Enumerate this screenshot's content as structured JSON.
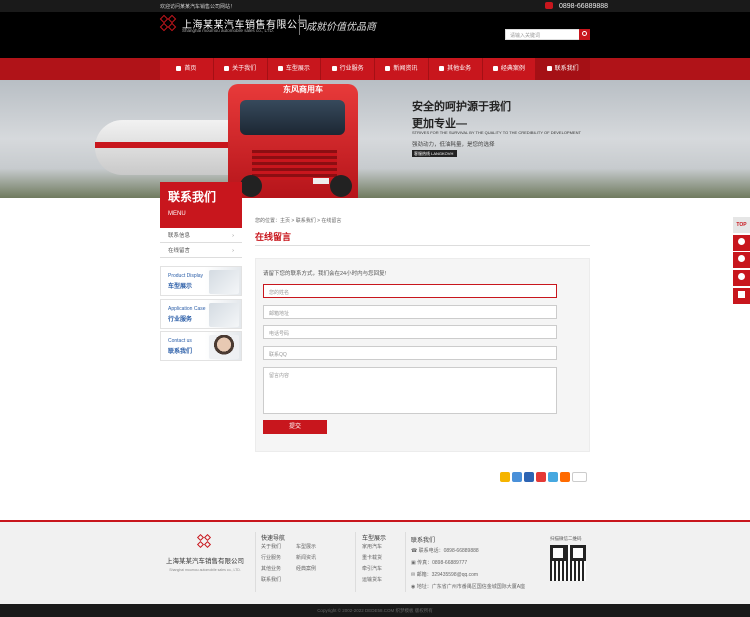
{
  "topbar": {
    "welcome": "欢迎访问某某汽车销售公司网站！",
    "phone": "0898-66889888"
  },
  "header": {
    "company_cn": "上海某某汽车销售有限公司",
    "company_en": "Shanghai moumou automobile sales co., LTD.",
    "slogan": "成就价值优品商",
    "search_placeholder": "请输入关键词"
  },
  "nav": [
    {
      "label": "首页",
      "icon": "home-icon"
    },
    {
      "label": "关于我们",
      "icon": "plane-icon"
    },
    {
      "label": "车型展示",
      "icon": "car-icon"
    },
    {
      "label": "行业服务",
      "icon": "gear-icon"
    },
    {
      "label": "新闻资讯",
      "icon": "news-icon"
    },
    {
      "label": "其他业务",
      "icon": "briefcase-icon"
    },
    {
      "label": "经典案例",
      "icon": "case-icon"
    },
    {
      "label": "联系我们",
      "icon": "phone-icon"
    }
  ],
  "banner": {
    "truck_text": "东风商用车",
    "line1": "安全的呵护源于我们",
    "line2": "更加专业—",
    "english": "STRIVES FOR THE SURVIVAL BY THE QUALITY TO THE CREDIBILITY OF DEVELOPMENT",
    "line3": "强劲动力，低油耗量，是您的选择",
    "button": "客服热线 LANGKOVH"
  },
  "sidebar": {
    "title_cn": "联系我们",
    "title_en": "MENU",
    "items": [
      {
        "label": "联系信息"
      },
      {
        "label": "在线留言"
      }
    ],
    "promos": [
      {
        "en": "Product Display",
        "cn": "车型展示"
      },
      {
        "en": "Application Case",
        "cn": "行业服务"
      },
      {
        "en": "Contact us",
        "cn": "联系我们"
      }
    ]
  },
  "main": {
    "breadcrumb": "您的位置：主页 > 联系我们 > 在线留言",
    "title": "在线留言",
    "intro": "请留下您的联系方式，我们会在24小时内与您回复!",
    "fields": {
      "name": "您的姓名",
      "email": "邮箱地址",
      "phone": "电话号码",
      "qq": "联系QQ",
      "message": "留言内容"
    },
    "submit": "提交"
  },
  "righttools": {
    "top": "TOP"
  },
  "footer": {
    "company_cn": "上海某某汽车销售有限公司",
    "company_en": "Shanghai moumou automobile sales co., LTD.",
    "col1": {
      "title": "快速导航",
      "links": [
        "关于我们",
        "车型展示",
        "行业服务",
        "新闻资讯",
        "其他业务",
        "经典案例",
        "联系我们"
      ]
    },
    "col2": {
      "title": "车型展示",
      "links": [
        "家用汽车",
        "重卡载货",
        "牵引汽车",
        "运输货车"
      ]
    },
    "col3": {
      "title": "联系我们",
      "items": [
        "联系电话：0898-66889888",
        "传真：0898-66889777",
        "邮箱：329435598@qq.com",
        "地址：广东省广州市番禺区国信金城国际大厦A座"
      ]
    },
    "qr_caption": "扫描微信二维码"
  },
  "copyright": "Copyright © 2002-2022 DEDE58.COM 织梦模板 版权所有"
}
